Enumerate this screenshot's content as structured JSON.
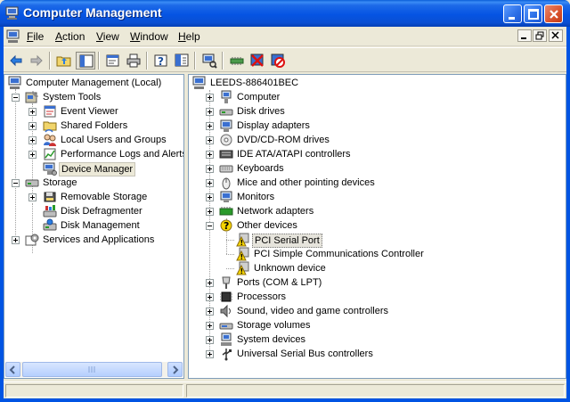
{
  "window": {
    "title": "Computer Management",
    "colors": {
      "titlebar": "#0554e3",
      "selection": "#e6e4dc",
      "warning": "#f5d400"
    }
  },
  "menu": {
    "items": [
      {
        "label": "File",
        "accel": "F"
      },
      {
        "label": "Action",
        "accel": "A"
      },
      {
        "label": "View",
        "accel": "V"
      },
      {
        "label": "Window",
        "accel": "W"
      },
      {
        "label": "Help",
        "accel": "H"
      }
    ]
  },
  "toolbar": {
    "buttons": [
      "back-icon",
      "forward-icon",
      "up-folder-icon",
      "show-hide-tree-icon",
      "properties-icon",
      "print-icon",
      "help-icon",
      "export-list-icon",
      "scan-hardware-icon",
      "update-driver-icon",
      "uninstall-icon",
      "disable-icon"
    ]
  },
  "left_tree": [
    {
      "label": "Computer Management (Local)",
      "icon": "computer-management-icon",
      "level": 0,
      "expander": "minus"
    },
    {
      "label": "System Tools",
      "icon": "system-tools-icon",
      "level": 1,
      "expander": "minus"
    },
    {
      "label": "Event Viewer",
      "icon": "event-viewer-icon",
      "level": 2,
      "expander": "plus"
    },
    {
      "label": "Shared Folders",
      "icon": "shared-folders-icon",
      "level": 2,
      "expander": "plus"
    },
    {
      "label": "Local Users and Groups",
      "icon": "users-icon",
      "level": 2,
      "expander": "plus"
    },
    {
      "label": "Performance Logs and Alerts",
      "icon": "performance-icon",
      "level": 2,
      "expander": "plus"
    },
    {
      "label": "Device Manager",
      "icon": "device-manager-icon",
      "level": 2,
      "expander": "none",
      "selected": true
    },
    {
      "label": "Storage",
      "icon": "storage-icon",
      "level": 1,
      "expander": "minus"
    },
    {
      "label": "Removable Storage",
      "icon": "removable-storage-icon",
      "level": 2,
      "expander": "plus"
    },
    {
      "label": "Disk Defragmenter",
      "icon": "defragmenter-icon",
      "level": 2,
      "expander": "none"
    },
    {
      "label": "Disk Management",
      "icon": "disk-management-icon",
      "level": 2,
      "expander": "none"
    },
    {
      "label": "Services and Applications",
      "icon": "services-icon",
      "level": 1,
      "expander": "plus"
    }
  ],
  "device_tree": {
    "root": "LEEDS-886401BEC",
    "items": [
      {
        "label": "Computer",
        "icon": "computer-icon",
        "level": 1,
        "expander": "plus"
      },
      {
        "label": "Disk drives",
        "icon": "disk-drive-icon",
        "level": 1,
        "expander": "plus"
      },
      {
        "label": "Display adapters",
        "icon": "display-adapter-icon",
        "level": 1,
        "expander": "plus"
      },
      {
        "label": "DVD/CD-ROM drives",
        "icon": "dvd-drive-icon",
        "level": 1,
        "expander": "plus"
      },
      {
        "label": "IDE ATA/ATAPI controllers",
        "icon": "ide-controller-icon",
        "level": 1,
        "expander": "plus"
      },
      {
        "label": "Keyboards",
        "icon": "keyboard-icon",
        "level": 1,
        "expander": "plus"
      },
      {
        "label": "Mice and other pointing devices",
        "icon": "mouse-icon",
        "level": 1,
        "expander": "plus"
      },
      {
        "label": "Monitors",
        "icon": "monitor-icon",
        "level": 1,
        "expander": "plus"
      },
      {
        "label": "Network adapters",
        "icon": "network-adapter-icon",
        "level": 1,
        "expander": "plus"
      },
      {
        "label": "Other devices",
        "icon": "other-devices-icon",
        "level": 1,
        "expander": "minus"
      },
      {
        "label": "PCI Serial Port",
        "icon": "warning-device-icon",
        "level": 2,
        "expander": "none",
        "selected": true
      },
      {
        "label": "PCI Simple Communications Controller",
        "icon": "warning-device-icon",
        "level": 2,
        "expander": "none"
      },
      {
        "label": "Unknown device",
        "icon": "warning-device-icon",
        "level": 2,
        "expander": "none"
      },
      {
        "label": "Ports (COM & LPT)",
        "icon": "port-icon",
        "level": 1,
        "expander": "plus"
      },
      {
        "label": "Processors",
        "icon": "processor-icon",
        "level": 1,
        "expander": "plus"
      },
      {
        "label": "Sound, video and game controllers",
        "icon": "sound-icon",
        "level": 1,
        "expander": "plus"
      },
      {
        "label": "Storage volumes",
        "icon": "storage-volume-icon",
        "level": 1,
        "expander": "plus"
      },
      {
        "label": "System devices",
        "icon": "system-devices-icon",
        "level": 1,
        "expander": "plus"
      },
      {
        "label": "Universal Serial Bus controllers",
        "icon": "usb-icon",
        "level": 1,
        "expander": "plus"
      }
    ]
  }
}
